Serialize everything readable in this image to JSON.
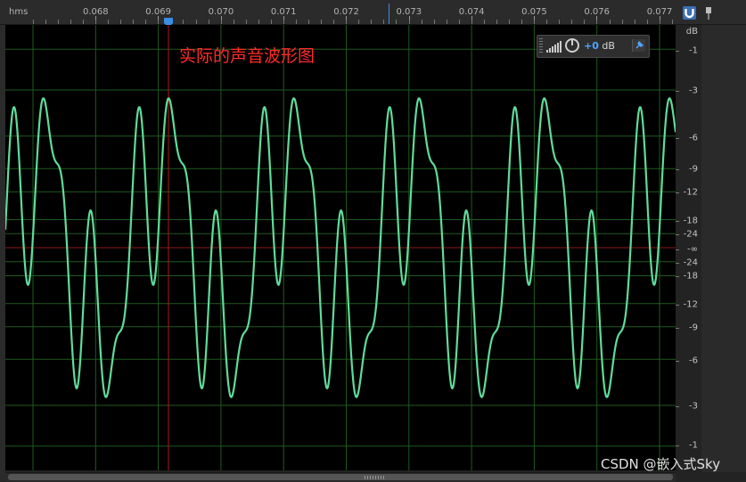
{
  "ruler": {
    "unit_label": "hms",
    "ticks": [
      "0.068",
      "0.069",
      "0.070",
      "0.071",
      "0.072",
      "0.073",
      "0.074",
      "0.075",
      "0.076",
      "0.077"
    ]
  },
  "annotation": {
    "text": "实际的声音波形图"
  },
  "volume_hud": {
    "value": "+0",
    "unit": "dB"
  },
  "db_scale": {
    "header": "dB",
    "labels": [
      "-1",
      "-3",
      "-6",
      "-9",
      "-12",
      "-18",
      "-24",
      "-∞",
      "-24",
      "-18",
      "-12",
      "-9",
      "-6",
      "-3",
      "-1"
    ]
  },
  "watermark": {
    "text": "CSDN @嵌入式Sky"
  },
  "colors": {
    "waveform": "#5fdc9a",
    "grid": "#1f5a1f",
    "playhead": "#b01818",
    "zero_line": "#8a1a1a",
    "accent": "#3a8ee6"
  }
}
